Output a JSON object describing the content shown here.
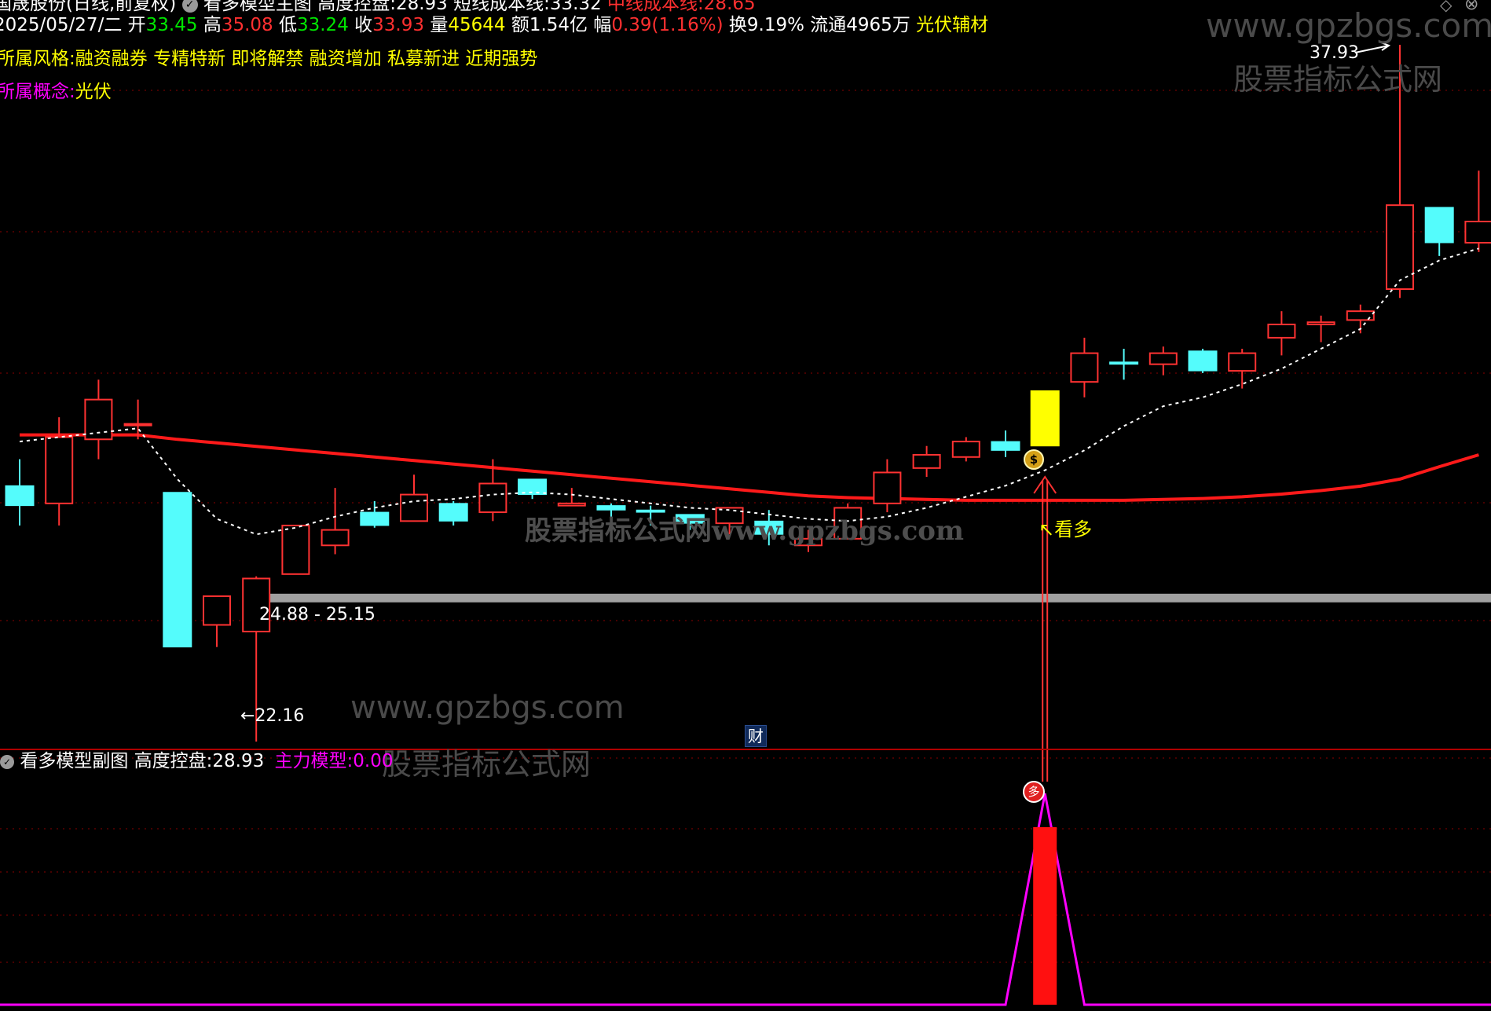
{
  "header": {
    "line1": {
      "stock_name": "国晟股份(日线,前复权)",
      "indicator_name": "看多模型主图",
      "kong_label": "高度控盘:",
      "kong_value": "28.93",
      "short_label": "短线成本线:",
      "short_value": "33.32",
      "mid_label": "中线成本线:",
      "mid_value": "28.65"
    },
    "line2": {
      "date": "2025/05/27/二",
      "open_label": "开",
      "open": "33.45",
      "high_label": "高",
      "high": "35.08",
      "low_label": "低",
      "low": "33.24",
      "close_label": "收",
      "close": "33.93",
      "vol_label": "量",
      "vol": "45644",
      "amount_label": "额",
      "amount": "1.54亿",
      "range_label": "幅",
      "range": "0.39(1.16%)",
      "turnover_label": "换",
      "turnover": "9.19%",
      "float_label": "流通",
      "float": "4965万",
      "industry": "光伏辅材"
    },
    "style_label": "所属风格:",
    "style_tags": [
      "融资融券",
      "专精特新",
      "即将解禁",
      "融资增加",
      "私募新进",
      "近期强势"
    ],
    "concept_label": "所属概念:",
    "concept_value": "光伏"
  },
  "sub_panel": {
    "title": "看多模型副图",
    "kong_label": "高度控盘:",
    "kong_value": "28.93",
    "model_label": "主力模型:",
    "model_value": "0.00"
  },
  "annotations": {
    "high_value": "37.93",
    "low_value": "22.16",
    "range_value": "24.88 - 25.15",
    "bull_label": "看多",
    "cai_badge": "财",
    "duo_badge": "多",
    "money_badge": "$"
  },
  "watermarks": {
    "site": "www.gpzbgs.com",
    "site_cn": "股票指标公式网",
    "center": "股票指标公式网www.gpzbgs.com"
  },
  "icons": [
    "diamond-icon",
    "close-circle-icon",
    "check-circle-icon",
    "money-bag-icon"
  ],
  "colors": {
    "background": "#000000",
    "up": "#ff3232",
    "down": "#54fcfc",
    "mid_line": "#ff1a1a",
    "short_line": "#ffffff",
    "signal": "#ffff00",
    "magenta": "#ff00ff",
    "grid": "#8b0000",
    "label_yellow": "#ffff00",
    "label_green": "#00e600",
    "support_bar": "#a0a0a0"
  },
  "chart_data": {
    "type": "candlestick",
    "y_scale_price_range": [
      21.5,
      38.6
    ],
    "candles": [
      {
        "o": 27.95,
        "h": 28.55,
        "l": 27.05,
        "c": 27.5
      },
      {
        "o": 27.55,
        "h": 29.5,
        "l": 27.05,
        "c": 29.05
      },
      {
        "o": 29.0,
        "h": 30.35,
        "l": 28.55,
        "c": 29.9
      },
      {
        "o": 29.35,
        "h": 29.9,
        "l": 29.0,
        "c": 29.35
      },
      {
        "o": 27.8,
        "h": 27.8,
        "l": 24.3,
        "c": 24.3
      },
      {
        "o": 24.8,
        "h": 25.45,
        "l": 24.3,
        "c": 25.45
      },
      {
        "o": 24.65,
        "h": 25.9,
        "l": 22.16,
        "c": 25.85
      },
      {
        "o": 25.95,
        "h": 27.05,
        "l": 25.95,
        "c": 27.05
      },
      {
        "o": 26.6,
        "h": 27.9,
        "l": 26.4,
        "c": 26.95
      },
      {
        "o": 27.35,
        "h": 27.6,
        "l": 27.0,
        "c": 27.05
      },
      {
        "o": 27.15,
        "h": 28.2,
        "l": 27.15,
        "c": 27.75
      },
      {
        "o": 27.55,
        "h": 27.6,
        "l": 27.05,
        "c": 27.15
      },
      {
        "o": 27.35,
        "h": 28.55,
        "l": 27.15,
        "c": 28.0
      },
      {
        "o": 28.1,
        "h": 28.1,
        "l": 27.65,
        "c": 27.75
      },
      {
        "o": 27.5,
        "h": 27.9,
        "l": 27.5,
        "c": 27.55
      },
      {
        "o": 27.5,
        "h": 27.55,
        "l": 27.15,
        "c": 27.4
      },
      {
        "o": 27.4,
        "h": 27.5,
        "l": 27.05,
        "c": 27.35
      },
      {
        "o": 27.3,
        "h": 27.3,
        "l": 26.95,
        "c": 27.1
      },
      {
        "o": 27.1,
        "h": 27.45,
        "l": 26.85,
        "c": 27.45
      },
      {
        "o": 27.15,
        "h": 27.4,
        "l": 26.6,
        "c": 26.85
      },
      {
        "o": 26.6,
        "h": 26.95,
        "l": 26.45,
        "c": 26.75
      },
      {
        "o": 26.75,
        "h": 27.55,
        "l": 26.75,
        "c": 27.45
      },
      {
        "o": 27.55,
        "h": 28.55,
        "l": 27.35,
        "c": 28.25
      },
      {
        "o": 28.35,
        "h": 28.85,
        "l": 28.15,
        "c": 28.65
      },
      {
        "o": 28.6,
        "h": 29.05,
        "l": 28.5,
        "c": 28.95
      },
      {
        "o": 28.95,
        "h": 29.2,
        "l": 28.6,
        "c": 28.75
      },
      {
        "o": 28.85,
        "h": 30.1,
        "l": 28.85,
        "c": 30.1
      },
      {
        "o": 30.3,
        "h": 31.3,
        "l": 29.95,
        "c": 30.95
      },
      {
        "o": 30.75,
        "h": 31.05,
        "l": 30.35,
        "c": 30.7
      },
      {
        "o": 30.7,
        "h": 31.1,
        "l": 30.45,
        "c": 30.95
      },
      {
        "o": 31.0,
        "h": 31.05,
        "l": 30.5,
        "c": 30.55
      },
      {
        "o": 30.55,
        "h": 31.05,
        "l": 30.15,
        "c": 30.95
      },
      {
        "o": 31.3,
        "h": 31.9,
        "l": 30.9,
        "c": 31.6
      },
      {
        "o": 31.6,
        "h": 31.8,
        "l": 31.2,
        "c": 31.65
      },
      {
        "o": 31.7,
        "h": 32.05,
        "l": 31.4,
        "c": 31.9
      },
      {
        "o": 32.4,
        "h": 37.93,
        "l": 32.2,
        "c": 34.3
      },
      {
        "o": 34.25,
        "h": 34.25,
        "l": 33.15,
        "c": 33.45
      },
      {
        "o": 33.45,
        "h": 35.08,
        "l": 33.24,
        "c": 33.93
      }
    ],
    "signal_candle_index": 26,
    "short_cost_line": [
      28.95,
      29.05,
      29.15,
      29.25,
      28.1,
      27.2,
      26.85,
      27.0,
      27.25,
      27.45,
      27.6,
      27.65,
      27.75,
      27.8,
      27.75,
      27.65,
      27.55,
      27.45,
      27.4,
      27.3,
      27.2,
      27.15,
      27.25,
      27.45,
      27.7,
      27.95,
      28.3,
      28.75,
      29.3,
      29.75,
      29.95,
      30.25,
      30.6,
      31.05,
      31.5,
      32.6,
      33.05,
      33.32
    ],
    "mid_cost_line": [
      29.1,
      29.1,
      29.1,
      29.1,
      29.0,
      28.92,
      28.84,
      28.76,
      28.68,
      28.6,
      28.52,
      28.44,
      28.36,
      28.28,
      28.2,
      28.12,
      28.04,
      27.96,
      27.88,
      27.8,
      27.72,
      27.68,
      27.66,
      27.64,
      27.62,
      27.62,
      27.62,
      27.62,
      27.62,
      27.64,
      27.66,
      27.7,
      27.76,
      27.84,
      27.94,
      28.1,
      28.38,
      28.65
    ],
    "support_band": [
      24.88,
      25.15
    ],
    "sub_model_values": [
      0,
      0,
      0,
      0,
      0,
      0,
      0,
      0,
      0,
      0,
      0,
      0,
      0,
      0,
      0,
      0,
      0,
      0,
      0,
      0,
      0,
      0,
      0,
      0,
      0,
      0,
      1,
      0,
      0,
      0,
      0,
      0,
      0,
      0,
      0,
      0,
      0,
      0
    ]
  }
}
